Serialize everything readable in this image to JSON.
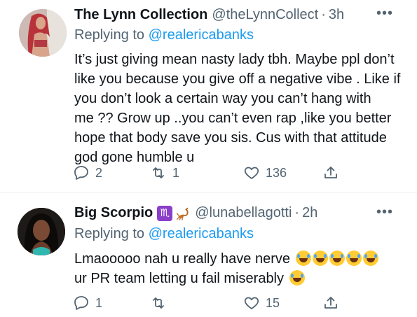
{
  "tweets": [
    {
      "name": "The Lynn Collection",
      "handle": "@theLynnCollect",
      "dot": "·",
      "time": "3h",
      "more": "•••",
      "replying_prefix": "Replying to",
      "replying_to": "@realericabanks",
      "body_lines": [
        "It’s just giving mean nasty lady tbh. Maybe ppl don’t",
        "like you because you give off a negative vibe . Like if",
        "you don’t look a certain way you can’t hang with",
        "me ?? Grow up ..you can’t even rap ,like you better",
        "hope that body save you sis. Cus with that attitude",
        "god gone humble u"
      ],
      "replies": "2",
      "retweets": "1",
      "likes": "136"
    },
    {
      "name": "Big Scorpio",
      "name_badge": "♏",
      "handle": "@lunabellagotti",
      "dot": "·",
      "time": "2h",
      "more": "•••",
      "replying_prefix": "Replying to",
      "replying_to": "@realericabanks",
      "body_lines": [
        "Lmaooooo nah u really have nerve",
        "ur PR team letting u fail miserably"
      ],
      "emoji_name": "face-with-tears-of-joy",
      "replies": "1",
      "retweets": "",
      "likes": "15"
    }
  ],
  "colors": {
    "text": "#0f1419",
    "secondary": "#536471",
    "link": "#1d9bf0",
    "divider": "#eff3f4"
  }
}
